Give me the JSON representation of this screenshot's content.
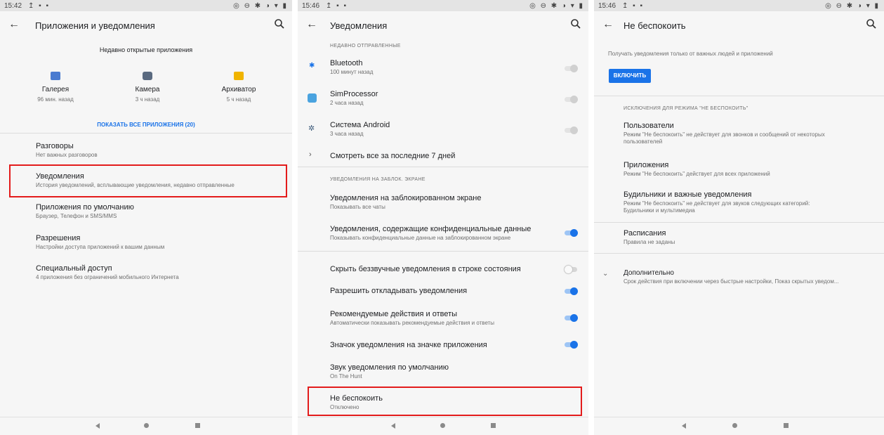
{
  "colors": {
    "accent": "#1a73e8",
    "highlight": "#e31b1b",
    "panel_bg": "#f6f6f6"
  },
  "panel1": {
    "status": {
      "time": "15:42",
      "left_icons": "↥ ▪ ▪",
      "right_icons": "◎ ⊖ ✱ ◑ ▾ ▮"
    },
    "title": "Приложения и уведомления",
    "recent_header": "Недавно открытые приложения",
    "recent_apps": [
      {
        "name": "Галерея",
        "time": "96 мин. назад",
        "icon": "gallery-icon",
        "color": "#4a7bd0"
      },
      {
        "name": "Камера",
        "time": "3 ч назад",
        "icon": "camera-icon",
        "color": "#5a6a80"
      },
      {
        "name": "Архиватор",
        "time": "5 ч назад",
        "icon": "archiver-icon",
        "color": "#f0b400"
      }
    ],
    "show_all": "ПОКАЗАТЬ ВСЕ ПРИЛОЖЕНИЯ (20)",
    "items": [
      {
        "title": "Разговоры",
        "subtitle": "Нет важных разговоров"
      },
      {
        "title": "Уведомления",
        "subtitle": "История уведомлений, всплывающие уведомления, недавно отправленные"
      },
      {
        "title": "Приложения по умолчанию",
        "subtitle": "Браузер, Телефон и SMS/MMS"
      },
      {
        "title": "Разрешения",
        "subtitle": "Настройки доступа приложений к вашим данным"
      },
      {
        "title": "Специальный доступ",
        "subtitle": "4 приложения без ограничений мобильного Интернета"
      }
    ]
  },
  "panel2": {
    "status": {
      "time": "15:46",
      "left_icons": "↥ ▪ ▪",
      "right_icons": "◎ ⊖ ✱ ◑ ▾ ▮"
    },
    "title": "Уведомления",
    "recent_header": "НЕДАВНО ОТПРАВЛЕННЫЕ",
    "recent": [
      {
        "title": "Bluetooth",
        "subtitle": "100 минут назад",
        "icon": "bluetooth-icon"
      },
      {
        "title": "SimProcessor",
        "subtitle": "2 часа назад",
        "icon": "simprocessor-icon"
      },
      {
        "title": "Система Android",
        "subtitle": "3 часа назад",
        "icon": "android-gear-icon"
      }
    ],
    "see_all": "Смотреть все за последние 7 дней",
    "lock_header": "УВЕДОМЛЕНИЯ НА ЗАБЛОК. ЭКРАНЕ",
    "lock_items": [
      {
        "title": "Уведомления на заблокированном экране",
        "subtitle": "Показывать все чаты"
      },
      {
        "title": "Уведомления, содержащие конфиденциальные данные",
        "subtitle": "Показывать конфиденциальные данные на заблокированном экране",
        "toggle": "on"
      }
    ],
    "settings": [
      {
        "title": "Скрыть беззвучные уведомления в строке состояния",
        "subtitle": "",
        "toggle": "off"
      },
      {
        "title": "Разрешить откладывать уведомления",
        "subtitle": "",
        "toggle": "on"
      },
      {
        "title": "Рекомендуемые действия и ответы",
        "subtitle": "Автоматически показывать рекомендуемые действия и ответы",
        "toggle": "on"
      },
      {
        "title": "Значок уведомления на значке приложения",
        "subtitle": "",
        "toggle": "on"
      },
      {
        "title": "Звук уведомления по умолчанию",
        "subtitle": "On The Hunt"
      },
      {
        "title": "Не беспокоить",
        "subtitle": "Отключено"
      }
    ]
  },
  "panel3": {
    "status": {
      "time": "15:46",
      "left_icons": "↥ ▪ ▪",
      "right_icons": "◎ ⊖ ✱ ◑ ▾ ▮"
    },
    "title": "Не беспокоить",
    "description": "Получать уведомления только от важных людей и приложений",
    "enable_button": "ВКЛЮЧИТЬ",
    "exceptions_header": "ИСКЛЮЧЕНИЯ ДЛЯ РЕЖИМА \"НЕ БЕСПОКОИТЬ\"",
    "exceptions": [
      {
        "title": "Пользователи",
        "subtitle_1": "Режим \"Не беспокоить\" не действует для звонков и сообщений от некоторых",
        "subtitle_2": "пользователей"
      },
      {
        "title": "Приложения",
        "subtitle_1": "Режим \"Не беспокоить\" действует для всех приложений",
        "subtitle_2": ""
      },
      {
        "title": "Будильники и важные уведомления",
        "subtitle_1": "Режим \"Не беспокоить\" не действует для звуков следующих категорий:",
        "subtitle_2": "Будильники и мультимедиа"
      }
    ],
    "schedules": {
      "title": "Расписания",
      "subtitle": "Правила не заданы"
    },
    "advanced": {
      "title": "Дополнительно",
      "subtitle": "Срок действия при включении через быстрые настройки, Показ скрытых уведом..."
    }
  }
}
